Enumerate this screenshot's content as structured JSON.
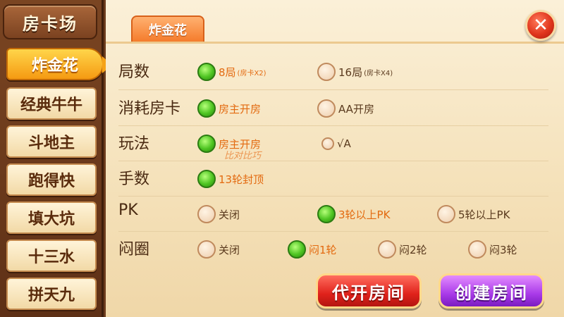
{
  "sidebar": {
    "title": "房卡场",
    "items": [
      {
        "label": "炸金花",
        "active": true
      },
      {
        "label": "经典牛牛",
        "active": false
      },
      {
        "label": "斗地主",
        "active": false
      },
      {
        "label": "跑得快",
        "active": false
      },
      {
        "label": "填大坑",
        "active": false
      },
      {
        "label": "十三水",
        "active": false
      },
      {
        "label": "拼天九",
        "active": false
      }
    ]
  },
  "main": {
    "tab_label": "炸金花",
    "close_symbol": "✕",
    "rows": [
      {
        "label": "局数",
        "options": [
          {
            "text": "8局",
            "small": "(房卡X2)",
            "selected": true
          },
          {
            "text": "16局",
            "small": "(房卡X4)",
            "selected": false
          }
        ]
      },
      {
        "label": "消耗房卡",
        "options": [
          {
            "text": "房主开房",
            "selected": true
          },
          {
            "text": "AA开房",
            "selected": false
          }
        ]
      },
      {
        "label": "玩法",
        "options": [
          {
            "text": "房主开房",
            "selected": true
          },
          {
            "text": "√A",
            "selected": false
          }
        ]
      },
      {
        "label": "手数",
        "options": [
          {
            "text": "13轮封顶",
            "selected": true
          }
        ]
      },
      {
        "label": "PK",
        "options": [
          {
            "text": "关闭",
            "selected": false
          },
          {
            "text": "3轮以上PK",
            "selected": true
          },
          {
            "text": "5轮以上PK",
            "selected": false
          }
        ]
      },
      {
        "label": "闷圈",
        "options": [
          {
            "text": "关闭",
            "selected": false
          },
          {
            "text": "闷1轮",
            "selected": true
          },
          {
            "text": "闷2轮",
            "selected": false
          },
          {
            "text": "闷3轮",
            "selected": false
          }
        ]
      }
    ],
    "glitch_text": "比对比巧",
    "buttons": {
      "proxy_open": "代开房间",
      "create": "创建房间"
    }
  },
  "colors": {
    "accent_orange": "#f47a2a",
    "selected_green": "#4ec422",
    "selected_text": "#e36a10",
    "red_button": "#e0221b",
    "purple_button": "#a93ae8"
  }
}
